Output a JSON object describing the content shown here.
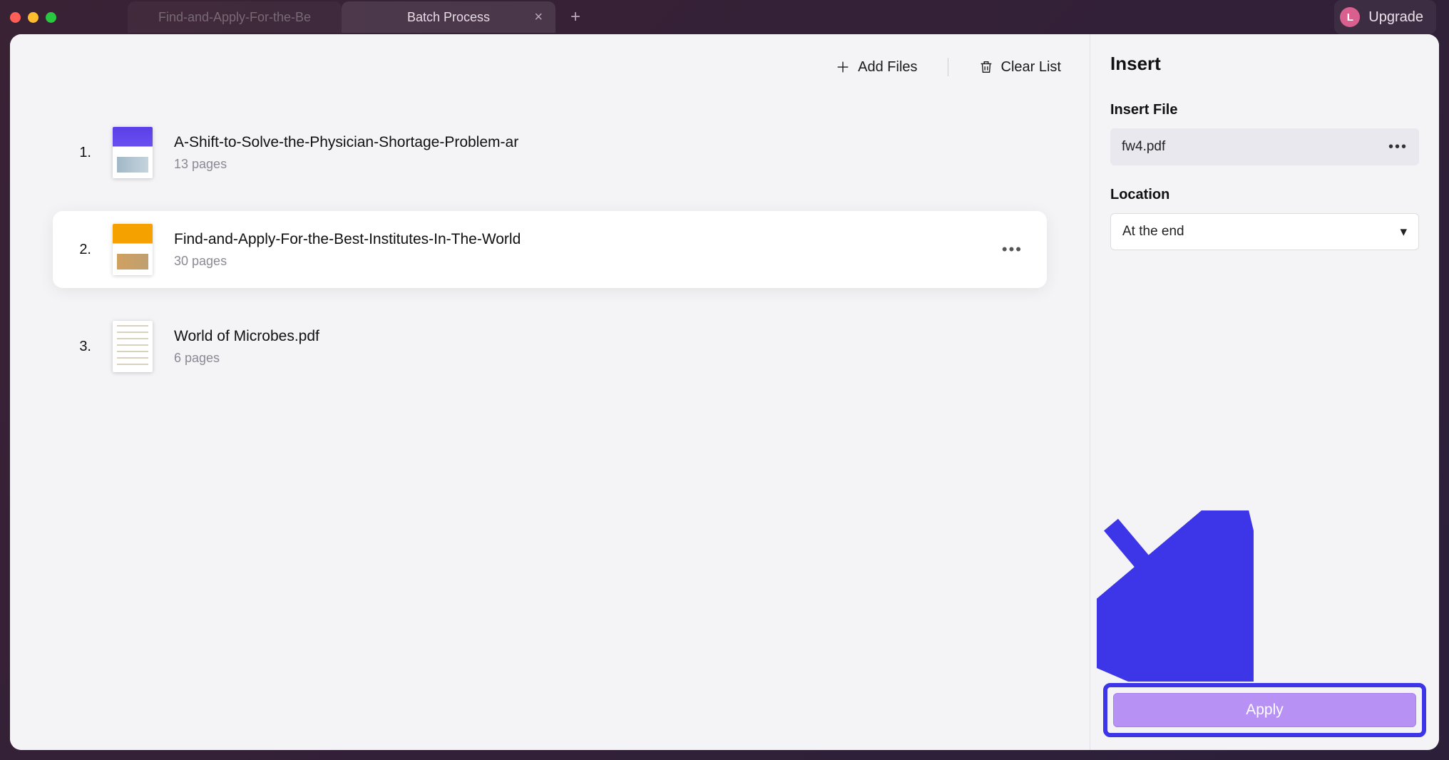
{
  "titlebar": {
    "tabs": [
      {
        "label": "Find-and-Apply-For-the-Be",
        "active": false
      },
      {
        "label": "Batch Process",
        "active": true
      }
    ],
    "avatar_initial": "L",
    "upgrade_label": "Upgrade"
  },
  "toolbar": {
    "add_files_label": "Add Files",
    "clear_list_label": "Clear List"
  },
  "files": [
    {
      "index": "1.",
      "title": "A-Shift-to-Solve-the-Physician-Shortage-Problem-ar",
      "pages": "13 pages",
      "selected": false
    },
    {
      "index": "2.",
      "title": "Find-and-Apply-For-the-Best-Institutes-In-The-World",
      "pages": "30 pages",
      "selected": true
    },
    {
      "index": "3.",
      "title": "World of Microbes.pdf",
      "pages": "6 pages",
      "selected": false
    }
  ],
  "sidebar": {
    "title": "Insert",
    "insert_file_label": "Insert File",
    "insert_file_value": "fw4.pdf",
    "location_label": "Location",
    "location_value": "At the end",
    "apply_label": "Apply"
  },
  "colors": {
    "accent_arrow": "#3d35e8",
    "apply_button": "#b792f4"
  }
}
